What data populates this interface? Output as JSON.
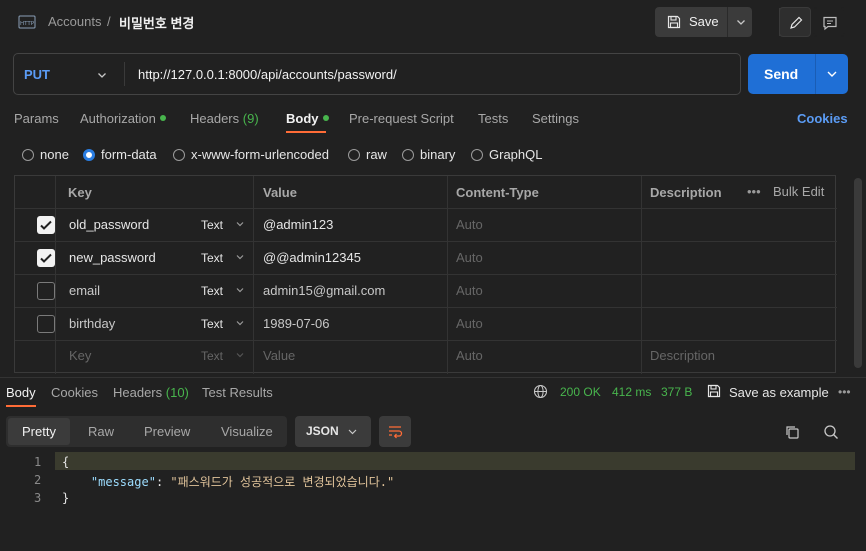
{
  "breadcrumb": {
    "collection": "Accounts",
    "separator": "/",
    "request": "비밀번호 변경"
  },
  "toolbar": {
    "save_label": "Save"
  },
  "request": {
    "method": "PUT",
    "url": "http://127.0.0.1:8000/api/accounts/password/",
    "send_label": "Send"
  },
  "tabs": {
    "params": "Params",
    "authorization": "Authorization",
    "headers": "Headers",
    "headers_count": "(9)",
    "body": "Body",
    "prerequest": "Pre-request Script",
    "tests": "Tests",
    "settings": "Settings",
    "cookies": "Cookies"
  },
  "body_types": [
    "none",
    "form-data",
    "x-www-form-urlencoded",
    "raw",
    "binary",
    "GraphQL"
  ],
  "body_selected": "form-data",
  "table": {
    "headers": {
      "key": "Key",
      "value": "Value",
      "content_type": "Content-Type",
      "description": "Description",
      "bulk_edit": "Bulk Edit",
      "more": "•••"
    },
    "rows": [
      {
        "checked": true,
        "key": "old_password",
        "type": "Text",
        "value": "@admin123",
        "content_type": "Auto"
      },
      {
        "checked": true,
        "key": "new_password",
        "type": "Text",
        "value": "@@admin12345",
        "content_type": "Auto"
      },
      {
        "checked": false,
        "key": "email",
        "type": "Text",
        "value": "admin15@gmail.com",
        "content_type": "Auto"
      },
      {
        "checked": false,
        "key": "birthday",
        "type": "Text",
        "value": "1989-07-06",
        "content_type": "Auto"
      }
    ],
    "placeholder": {
      "key": "Key",
      "type": "Text",
      "value": "Value",
      "content_type": "Auto",
      "description": "Description"
    }
  },
  "response": {
    "tabs": {
      "body": "Body",
      "cookies": "Cookies",
      "headers": "Headers",
      "headers_count": "(10)",
      "test_results": "Test Results"
    },
    "status": "200 OK",
    "time": "412 ms",
    "size": "377 B",
    "save_example": "Save as example",
    "more": "•••",
    "formats": [
      "Pretty",
      "Raw",
      "Preview",
      "Visualize"
    ],
    "format_selected": "Pretty",
    "language": "JSON",
    "lines": [
      "1",
      "2",
      "3"
    ],
    "code": {
      "open": "{",
      "key": "\"message\"",
      "colon": ": ",
      "value": "\"패스워드가 성공적으로 변경되었습니다.\"",
      "close": "}"
    }
  },
  "colors": {
    "accent": "#ff6c37",
    "primary": "#1f6fd6",
    "success": "#48b54d",
    "link": "#5b9cf5"
  }
}
